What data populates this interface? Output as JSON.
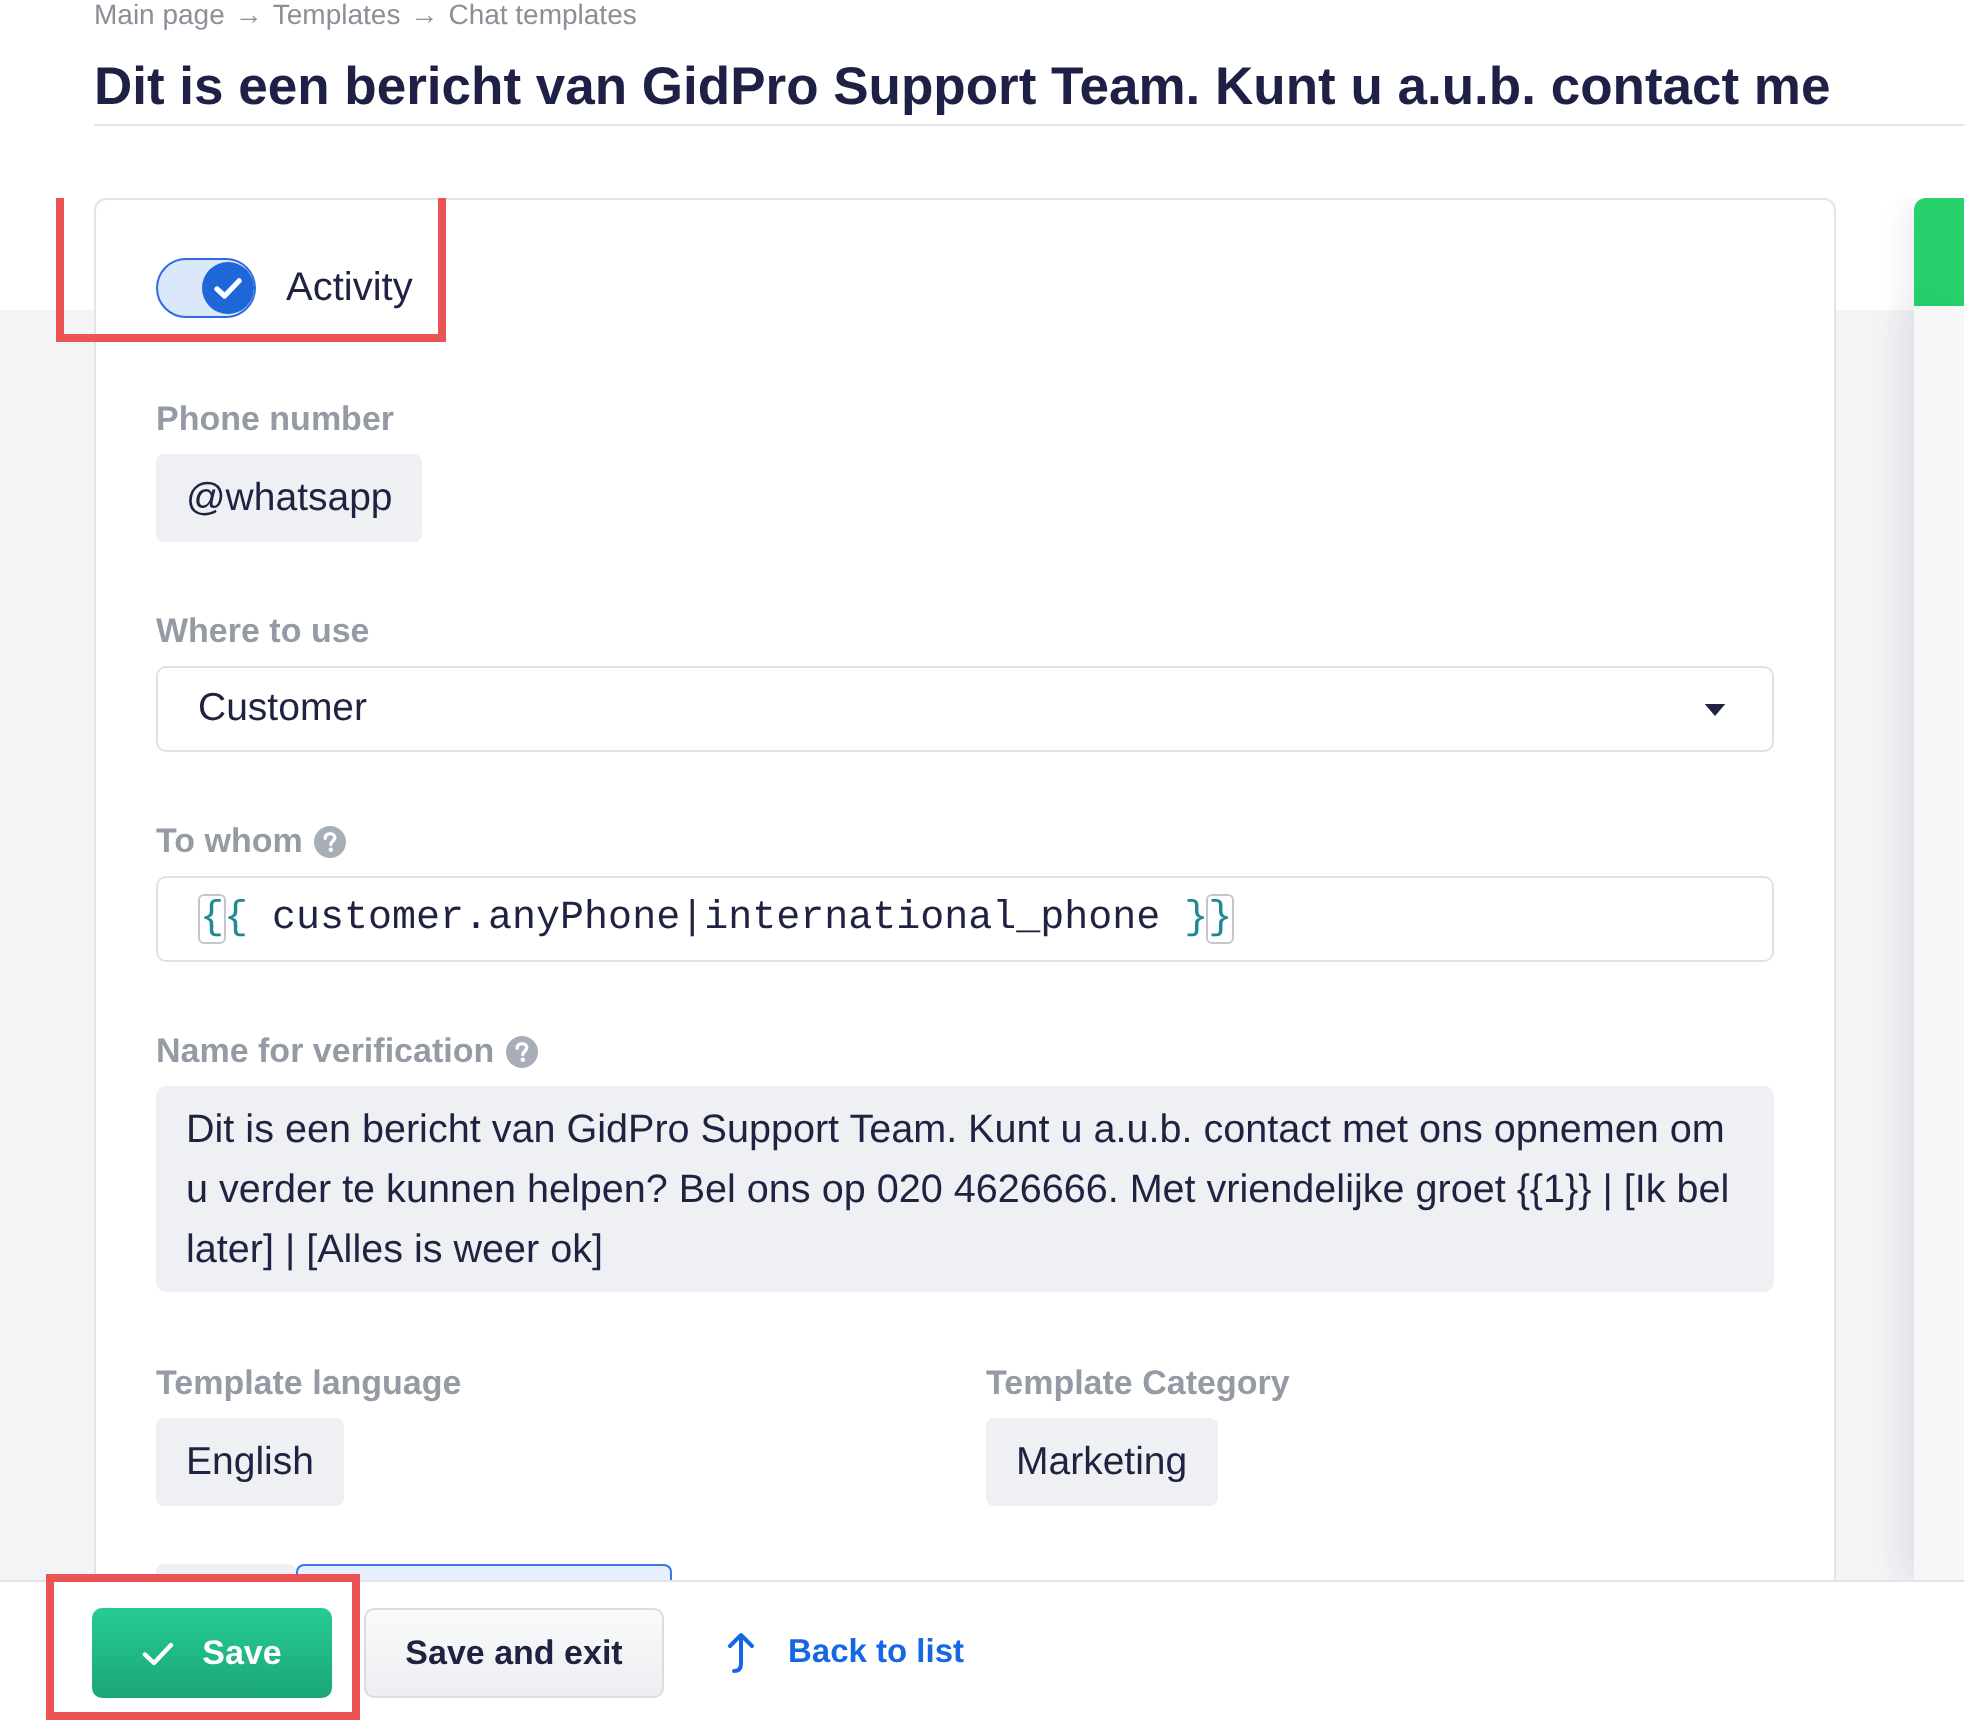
{
  "breadcrumb": [
    {
      "kind": "link",
      "text": "Main page"
    },
    {
      "kind": "separator",
      "text": "→"
    },
    {
      "kind": "link",
      "text": "Templates"
    },
    {
      "kind": "separator",
      "text": "→"
    },
    {
      "kind": "current",
      "text": "Chat templates"
    }
  ],
  "title": "Dit is een bericht van GidPro Support Team. Kunt u a.u.b. contact me",
  "activity": {
    "label": "Activity",
    "on": true,
    "highlighted": true
  },
  "fields": [
    {
      "kind": "chip",
      "label": "Phone number",
      "help": false,
      "value": "@whatsapp"
    },
    {
      "kind": "select",
      "label": "Where to use",
      "help": false,
      "value": "Customer"
    },
    {
      "kind": "code",
      "label": "To whom",
      "help": true,
      "tokens": [
        {
          "kind": "matched",
          "text": "{"
        },
        {
          "kind": "brace",
          "text": "{"
        },
        {
          "kind": "code",
          "text": " customer.anyPhone|international_phone "
        },
        {
          "kind": "brace",
          "text": "}"
        },
        {
          "kind": "matched",
          "text": "}"
        }
      ]
    },
    {
      "kind": "text",
      "label": "Name for verification",
      "help": true,
      "value": "Dit is een bericht van GidPro Support Team. Kunt u a.u.b. contact met ons opnemen om u verder te kunnen helpen? Bel ons op 020 4626666. Met vriendelijke groet {{1}} | [Ik bel later] | [Alles is weer ok]"
    }
  ],
  "template_fields": [
    {
      "label": "Template language",
      "value": "English"
    },
    {
      "label": "Template Category",
      "value": "Marketing"
    }
  ],
  "tabs": [
    {
      "selected": false
    },
    {
      "selected": true
    }
  ],
  "footer": {
    "buttons": [
      {
        "kind": "primary",
        "label": "Save",
        "highlighted": true
      },
      {
        "kind": "secondary",
        "label": "Save and exit",
        "highlighted": false
      },
      {
        "kind": "link",
        "label": "Back to list",
        "highlighted": false
      }
    ]
  }
}
